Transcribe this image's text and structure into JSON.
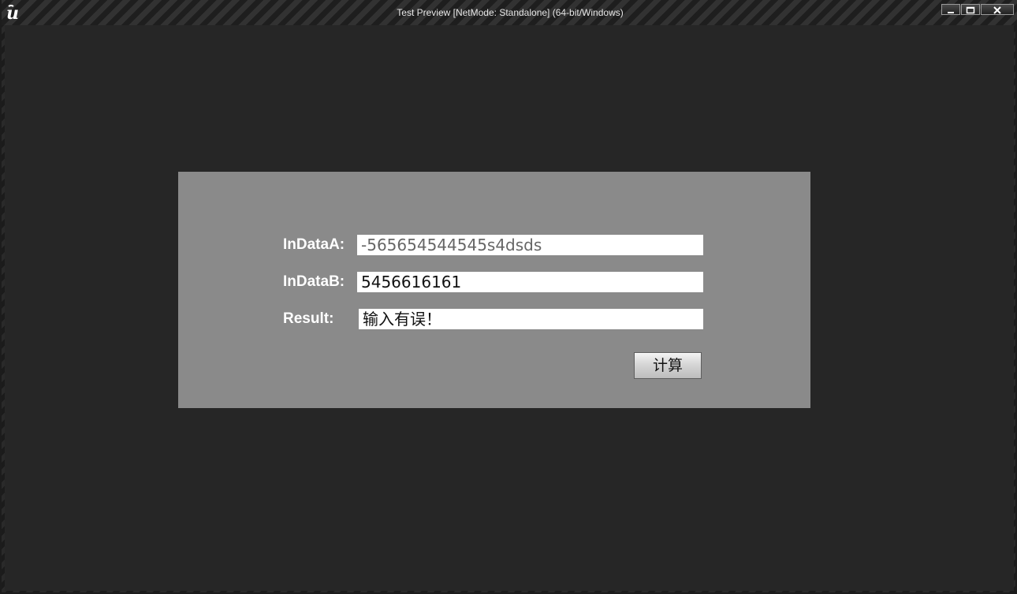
{
  "window": {
    "title": "Test Preview [NetMode: Standalone] (64-bit/Windows)"
  },
  "titlebar": {
    "logo_icon": "unreal-engine-logo-icon",
    "controls": [
      "minimize-icon",
      "maximize-icon",
      "close-icon"
    ]
  },
  "form": {
    "in_data_a": {
      "label": "InDataA:",
      "value": "-565654544545s4dsds"
    },
    "in_data_b": {
      "label": "InDataB:",
      "value": "5456616161"
    },
    "result": {
      "label": "Result:",
      "value": "输入有误！"
    },
    "calculate_label": "计算"
  }
}
